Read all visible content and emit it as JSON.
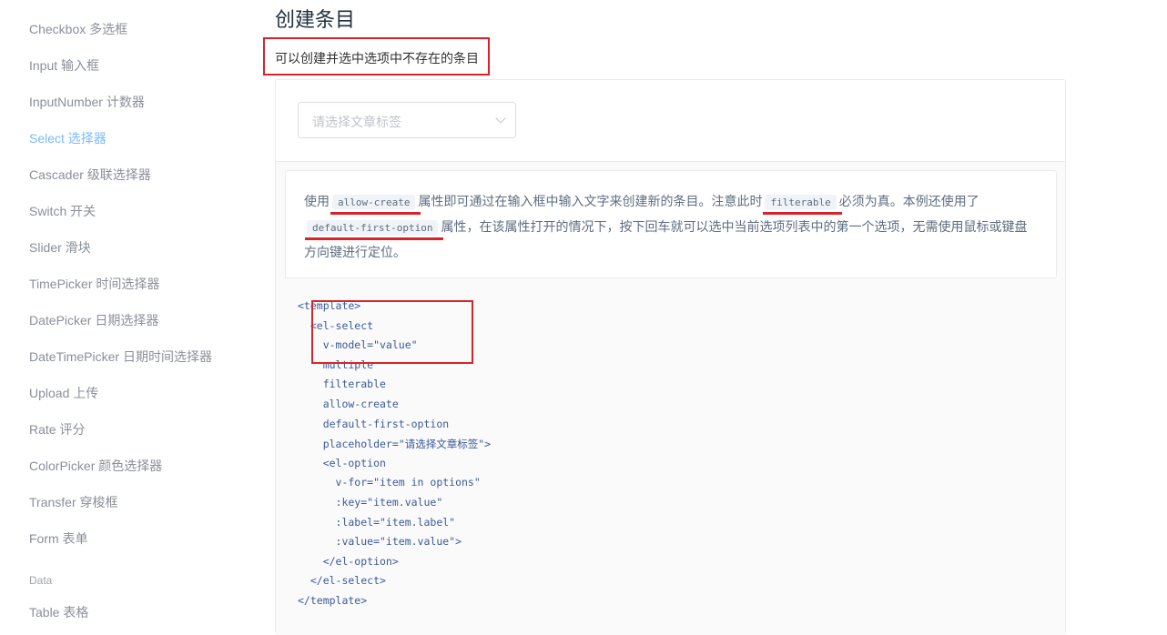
{
  "sidebar": {
    "items": [
      {
        "label": "Checkbox 多选框",
        "active": false
      },
      {
        "label": "Input 输入框",
        "active": false
      },
      {
        "label": "InputNumber 计数器",
        "active": false
      },
      {
        "label": "Select 选择器",
        "active": true
      },
      {
        "label": "Cascader 级联选择器",
        "active": false
      },
      {
        "label": "Switch 开关",
        "active": false
      },
      {
        "label": "Slider 滑块",
        "active": false
      },
      {
        "label": "TimePicker 时间选择器",
        "active": false
      },
      {
        "label": "DatePicker 日期选择器",
        "active": false
      },
      {
        "label": "DateTimePicker 日期时间选择器",
        "active": false
      },
      {
        "label": "Upload 上传",
        "active": false
      },
      {
        "label": "Rate 评分",
        "active": false
      },
      {
        "label": "ColorPicker 颜色选择器",
        "active": false
      },
      {
        "label": "Transfer 穿梭框",
        "active": false
      },
      {
        "label": "Form 表单",
        "active": false
      }
    ],
    "group_label": "Data",
    "after_group": [
      {
        "label": "Table 表格",
        "active": false
      }
    ]
  },
  "main": {
    "title": "创建条目",
    "description": "可以创建并选中选项中不存在的条目",
    "select_placeholder": "请选择文章标签",
    "explain": {
      "p1": "使用",
      "code1": "allow-create",
      "p2": "属性即可通过在输入框中输入文字来创建新的条目。注意此时",
      "code2": "filterable",
      "p3": "必须为真。本例还使用了",
      "code3": "default-first-option",
      "p4": "属性，在该属性打开的情况下，按下回车就可以选中当前选项列表中的第一个选项，无需使用鼠标或键盘方向键进行定位。"
    },
    "code_lines": [
      "<template>",
      "  <el-select",
      "    v-model=\"value\"",
      "    multiple",
      "    filterable",
      "    allow-create",
      "    default-first-option",
      "    placeholder=\"请选择文章标签\">",
      "    <el-option",
      "      v-for=\"item in options\"",
      "      :key=\"item.value\"",
      "      :label=\"item.label\"",
      "      :value=\"item.value\">",
      "    </el-option>",
      "  </el-select>",
      "</template>"
    ]
  },
  "colors": {
    "accent": "#409eff",
    "annotation": "#d9232b"
  }
}
